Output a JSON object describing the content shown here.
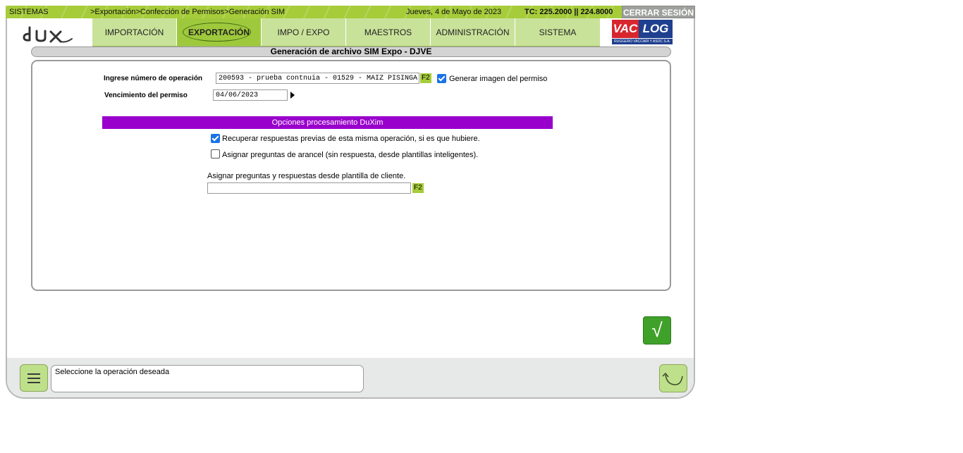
{
  "topbar": {
    "module": "SISTEMAS",
    "breadcrumb": ">Exportación>Confección de Permisos>Generación SIM",
    "date": "Jueves, 4 de Mayo de 2023",
    "exchange_rate": "TC: 225.2000 || 224.8000",
    "logout_label": "CERRAR SESIÓN"
  },
  "nav": {
    "tabs": [
      {
        "label": "IMPORTACIÓN"
      },
      {
        "label": "EXPORTACIÓN"
      },
      {
        "label": "IMPO / EXPO"
      },
      {
        "label": "MAESTROS"
      },
      {
        "label": "ADMINISTRACIÓN"
      },
      {
        "label": "SISTEMA"
      }
    ],
    "active_tab": "EXPORTACIÓN"
  },
  "brand": {
    "left_logo": "dux",
    "right_logo_a": "VAC",
    "right_logo_b": "LOG",
    "right_logo_sub": "RUGGERO VACCARI Y ASOC S.A."
  },
  "page": {
    "title": "Generación de archivo SIM Expo - DJVE"
  },
  "form": {
    "operation_label": "Ingrese número de operación",
    "operation_value": "200593 - prueba contnuia - 01529 - MAIZ PISINGA",
    "f2_label": "F2",
    "generate_image_label": "Generar imagen del permiso",
    "generate_image_checked": true,
    "expiry_label": "Vencimiento del permiso",
    "expiry_value": "04/06/2023"
  },
  "duxim": {
    "header": "Opciones procesamiento DuXim",
    "option1_label": "Recuperar respuestas previas de esta misma operación, si es que hubiere.",
    "option1_checked": true,
    "option2_label": "Asignar preguntas de arancel (sin respuesta, desde plantillas inteligentes).",
    "option2_checked": false,
    "template_label": "Asignar preguntas y respuestas desde plantilla de cliente.",
    "template_value": "",
    "template_f2": "F2"
  },
  "actions": {
    "confirm_symbol": "√"
  },
  "footer": {
    "status_text": "Seleccione la operación deseada"
  },
  "colors": {
    "accent_green": "#a6cc3a",
    "section_purple": "#9900cc",
    "confirm_green": "#3fa12a"
  }
}
